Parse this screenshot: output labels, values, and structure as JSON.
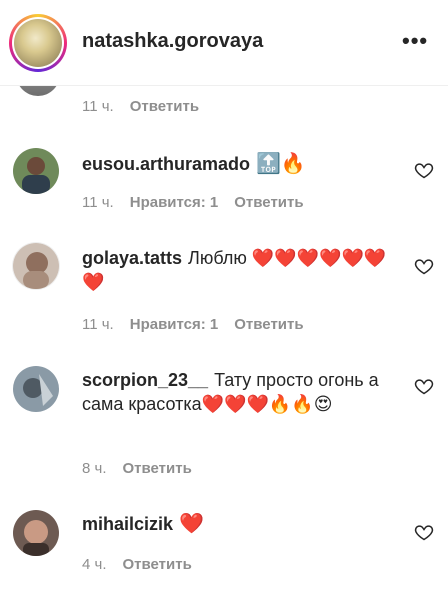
{
  "header": {
    "username": "natashka.gorovaya",
    "more": "•••"
  },
  "top_meta": {
    "time": "11 ч.",
    "reply": "Ответить"
  },
  "comments": [
    {
      "user": "eusou.arthuramado",
      "text": "🔝🔥",
      "time": "11 ч.",
      "likes": "Нравится: 1",
      "reply": "Ответить"
    },
    {
      "user": "golaya.tatts",
      "text": "Люблю ❤️❤️❤️❤️❤️❤️❤️",
      "time": "11 ч.",
      "likes": "Нравится: 1",
      "reply": "Ответить"
    },
    {
      "user": "scorpion_23__",
      "text": "Тату просто огонь а сама красотка❤️❤️❤️🔥🔥😍",
      "time": "8 ч.",
      "likes": "",
      "reply": "Ответить"
    },
    {
      "user": "mihailcizik",
      "text": "❤️",
      "time": "4 ч.",
      "likes": "",
      "reply": "Ответить"
    }
  ],
  "icons": {
    "like": "heart-outline-icon",
    "more": "more-horizontal-icon"
  },
  "colors": {
    "text": "#262626",
    "secondary": "#8e8e8e",
    "divider": "#efefef"
  }
}
